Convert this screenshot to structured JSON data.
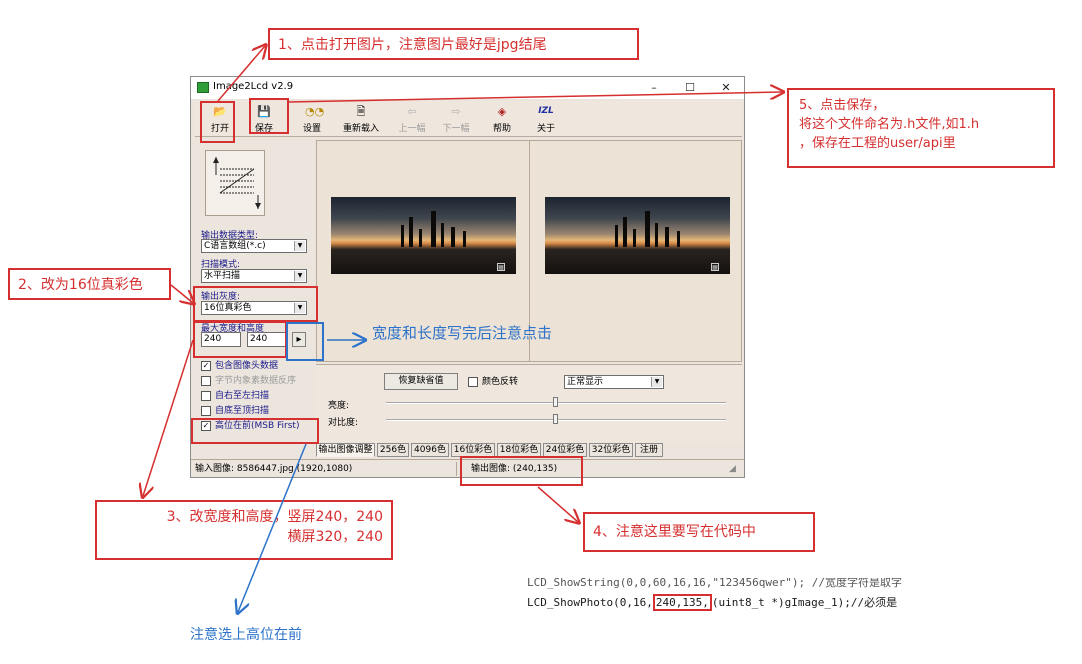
{
  "window": {
    "title": "Image2Lcd v2.9",
    "controls": {
      "minimize": "–",
      "maximize": "☐",
      "close": "✕"
    }
  },
  "toolbar": {
    "open": "打开",
    "save": "保存",
    "settings": "设置",
    "reload": "重新载入",
    "prev": "上一幅",
    "next": "下一幅",
    "help": "帮助",
    "about": "关于",
    "about_icon_text": "IZL"
  },
  "left_panel": {
    "output_type_label": "输出数据类型:",
    "output_type_value": "C语言数组(*.c)",
    "scan_mode_label": "扫描模式:",
    "scan_mode_value": "水平扫描",
    "depth_label": "输出灰度:",
    "depth_value": "16位真彩色",
    "size_label": "最大宽度和高度",
    "width": "240",
    "height": "240",
    "apply_btn": "▸",
    "checkboxes": [
      {
        "label": "包含图像头数据",
        "checked": true,
        "enabled": true
      },
      {
        "label": "字节内象素数据反序",
        "checked": false,
        "enabled": false
      },
      {
        "label": "自右至左扫描",
        "checked": false,
        "enabled": true
      },
      {
        "label": "自底至顶扫描",
        "checked": false,
        "enabled": true
      },
      {
        "label": "高位在前(MSB First)",
        "checked": true,
        "enabled": true
      }
    ]
  },
  "adjust": {
    "restore_default": "恢复缺省值",
    "invert_label": "颜色反转",
    "display_mode": "正常显示",
    "brightness_label": "亮度:",
    "contrast_label": "对比度:",
    "brightness_level": 0.5,
    "contrast_level": 0.5
  },
  "tabs": [
    "输出图像调整",
    "256色",
    "4096色",
    "16位彩色",
    "18位彩色",
    "24位彩色",
    "32位彩色",
    "注册"
  ],
  "status": {
    "input": "输入图像: 8586447.jpg (1920,1080)",
    "output": "输出图像: (240,135)"
  },
  "annotations": {
    "step1": "1、点击打开图片，注意图片最好是jpg结尾",
    "step2": "2、改为16位真彩色",
    "step3_line1": "3、改宽度和高度，竖屏240，240",
    "step3_line2": "横屏320，240",
    "step4": "4、注意这里要写在代码中",
    "step5_line1": "5、点击保存，",
    "step5_line2": "将这个文件命名为.h文件,如1.h",
    "step5_line3": "，保存在工程的user/api里",
    "note_size": "宽度和长度写完后注意点击",
    "note_msb": "注意选上高位在前"
  },
  "code": {
    "line1": "LCD_ShowString(0,0,60,16,16,\"123456qwer\");           //宽度字符是取字",
    "line2_prefix": "LCD_ShowPhoto(0,16,",
    "line2_highlight": "240,135,",
    "line2_suffix": "(uint8_t *)gImage_1);//必须是"
  },
  "colors": {
    "annotation_red": "#d62f2f",
    "annotation_blue": "#2c73c9",
    "window_bg": "#ece5dd"
  }
}
